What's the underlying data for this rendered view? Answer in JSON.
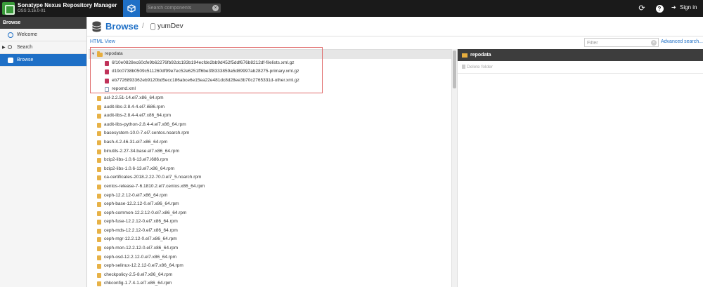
{
  "header": {
    "title": "Sonatype Nexus Repository Manager",
    "version": "OSS 3.16.0-01",
    "search_placeholder": "Search components",
    "signin_label": "Sign in"
  },
  "sidebar": {
    "section": "Browse",
    "items": [
      {
        "label": "Welcome"
      },
      {
        "label": "Search"
      },
      {
        "label": "Browse"
      }
    ]
  },
  "page": {
    "title": "Browse",
    "repo": "yumDev",
    "html_view": "HTML View",
    "filter_placeholder": "Filter",
    "advanced_search": "Advanced search..."
  },
  "tree": {
    "root": "repodata",
    "repodata_children": [
      {
        "name": "6f10e0828ec60cfe9b62276fb92dc193b194ecfde2bb9d452f5ddf676b8212df-filelists.xml.gz",
        "kind": "gz"
      },
      {
        "name": "d19c0738b0509c511260df99e7ec52e6251ff6be3f8333859a5d89997ab28275-primary.xml.gz",
        "kind": "gz"
      },
      {
        "name": "eb7726893362eb9120bd5ecc186abce6e15ea22e481dc8d28ee3b70c2765331d-other.xml.gz",
        "kind": "gz"
      },
      {
        "name": "repomd.xml",
        "kind": "xml"
      }
    ],
    "packages": [
      "acl-2.2.51-14.el7.x86_64.rpm",
      "audit-libs-2.8.4-4.el7.i686.rpm",
      "audit-libs-2.8.4-4.el7.x86_64.rpm",
      "audit-libs-python-2.8.4-4.el7.x86_64.rpm",
      "basesystem-10.0-7.el7.centos.noarch.rpm",
      "bash-4.2.46-31.el7.x86_64.rpm",
      "binutils-2.27-34.base.el7.x86_64.rpm",
      "bzip2-libs-1.0.6-13.el7.i686.rpm",
      "bzip2-libs-1.0.6-13.el7.x86_64.rpm",
      "ca-certificates-2018.2.22-70.0.el7_5.noarch.rpm",
      "centos-release-7-6.1810.2.el7.centos.x86_64.rpm",
      "ceph-12.2.12-0.el7.x86_64.rpm",
      "ceph-base-12.2.12-0.el7.x86_64.rpm",
      "ceph-common-12.2.12-0.el7.x86_64.rpm",
      "ceph-fuse-12.2.12-0.el7.x86_64.rpm",
      "ceph-mds-12.2.12-0.el7.x86_64.rpm",
      "ceph-mgr-12.2.12-0.el7.x86_64.rpm",
      "ceph-mon-12.2.12-0.el7.x86_64.rpm",
      "ceph-osd-12.2.12-0.el7.x86_64.rpm",
      "ceph-selinux-12.2.12-0.el7.x86_64.rpm",
      "checkpolicy-2.5-8.el7.x86_64.rpm",
      "chkconfig-1.7.4-1.el7.x86_64.rpm"
    ]
  },
  "detail": {
    "title": "repodata",
    "delete_label": "Delete folder"
  }
}
